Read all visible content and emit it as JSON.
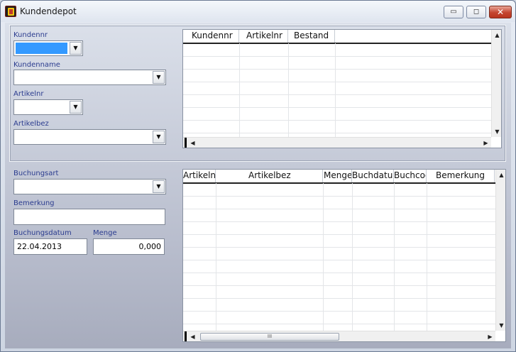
{
  "window": {
    "title": "Kundendepot",
    "minimize_glyph": "▭",
    "maximize_glyph": "◻",
    "close_glyph": "✕"
  },
  "top": {
    "kundennr_label": "Kundennr",
    "kundenname_label": "Kundenname",
    "artikelnr_label": "Artikelnr",
    "artikelbez_label": "Artikelbez",
    "grid": {
      "columns": [
        "Kundennr",
        "Artikelnr",
        "Bestand"
      ]
    }
  },
  "bottom": {
    "buchungsart_label": "Buchungsart",
    "bemerkung_label": "Bemerkung",
    "buchungsdatum_label": "Buchungsdatum",
    "buchungsdatum_value": "22.04.2013",
    "menge_label": "Menge",
    "menge_value": "0,000",
    "grid": {
      "columns": [
        "Artikelnr",
        "Artikelbez",
        "Menge",
        "Buchdatum",
        "Buchcode",
        "Bemerkung"
      ]
    }
  },
  "icons": {
    "dropdown": "▼",
    "scroll_up": "▲",
    "scroll_down": "▼",
    "scroll_left": "◀",
    "scroll_right": "▶",
    "thumb_grip": "III"
  }
}
